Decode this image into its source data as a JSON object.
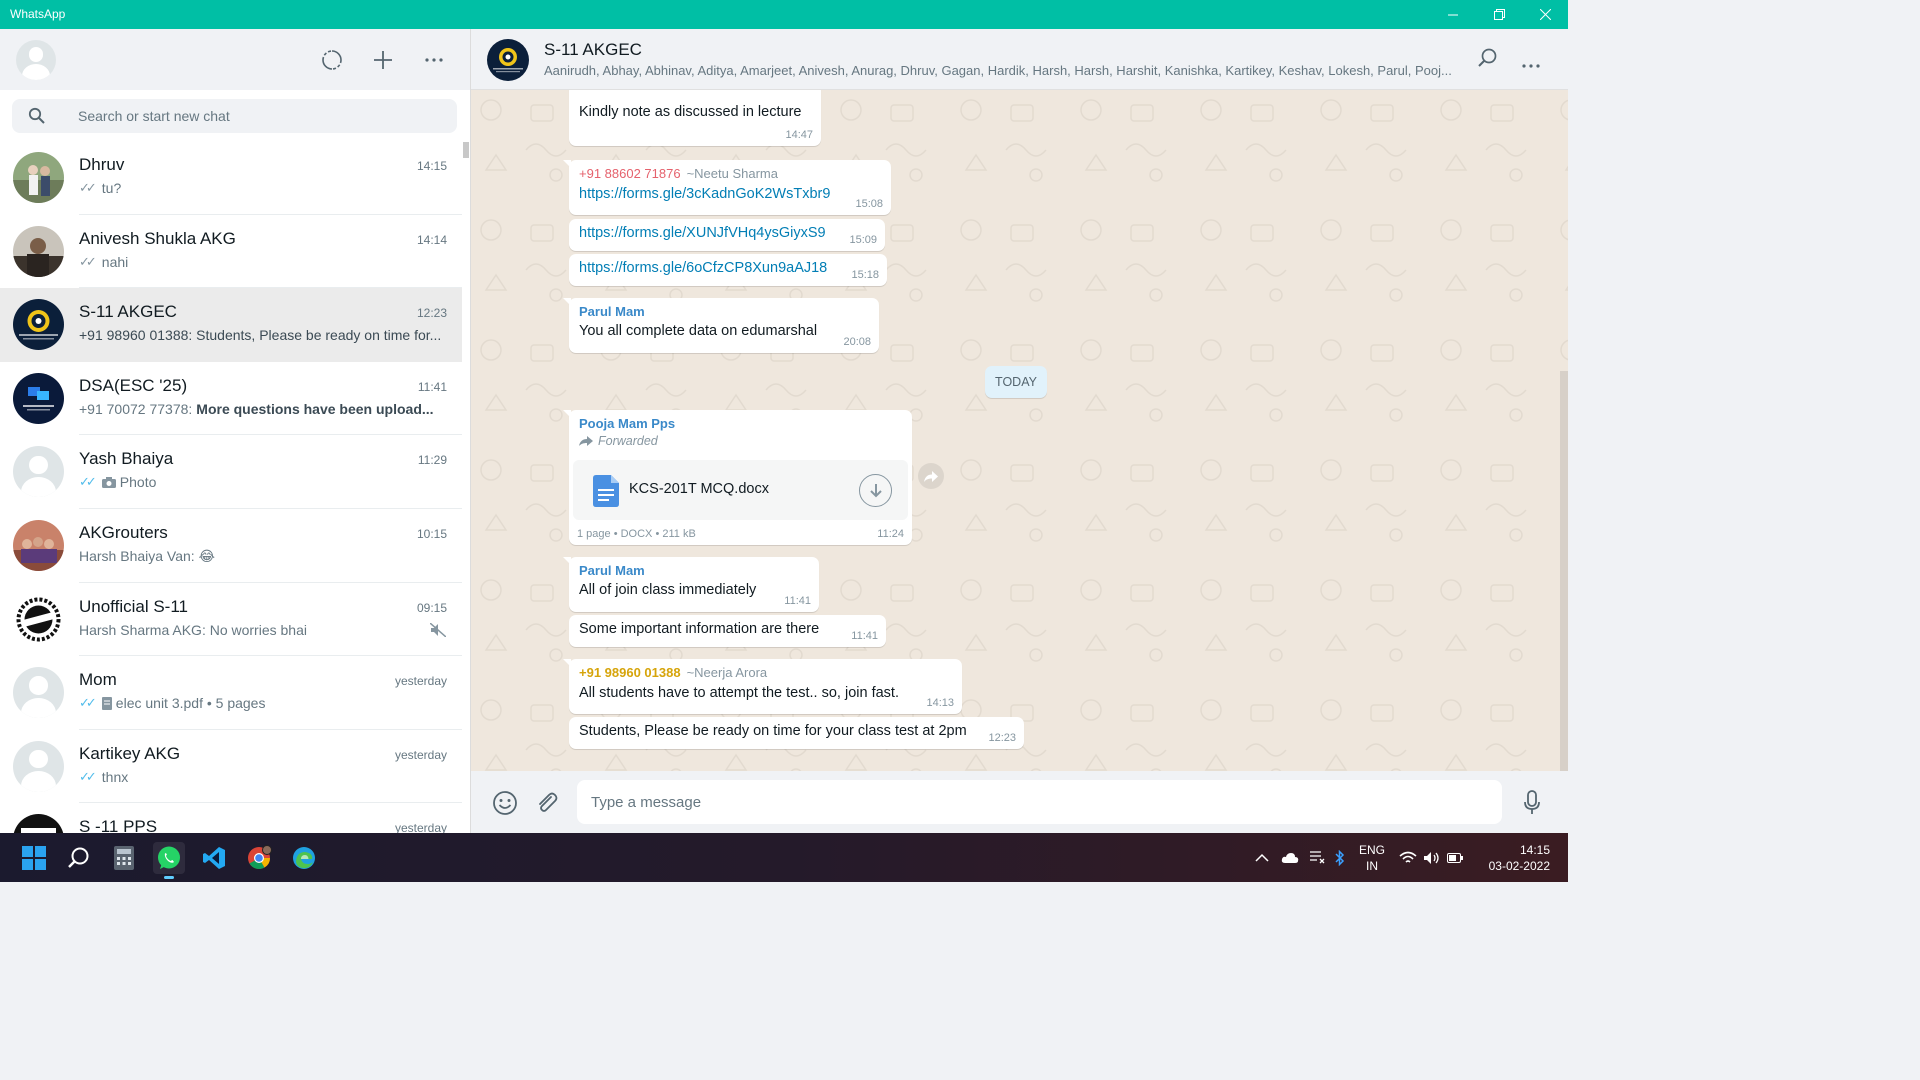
{
  "window": {
    "title": "WhatsApp"
  },
  "left_panel": {
    "search_placeholder": "Search or start new chat",
    "chats": [
      {
        "name": "Dhruv",
        "time": "14:15",
        "tick": "sent",
        "preview": "tu?"
      },
      {
        "name": "Anivesh Shukla AKG",
        "time": "14:14",
        "tick": "sent",
        "preview": "nahi"
      },
      {
        "name": "S-11 AKGEC",
        "time": "12:23",
        "preview": "+91 98960 01388: Students, Please be ready on time for..."
      },
      {
        "name": "DSA(ESC '25)",
        "time": "11:41",
        "preview_prefix": "+91 70072 77378: ",
        "preview_bold": "More questions have been upload..."
      },
      {
        "name": "Yash Bhaiya",
        "time": "11:29",
        "tick": "read",
        "preview": "Photo"
      },
      {
        "name": "AKGrouters",
        "time": "10:15",
        "preview": "Harsh Bhaiya Van: 😂"
      },
      {
        "name": "Unofficial S-11",
        "time": "09:15",
        "preview": "Harsh Sharma AKG: No worries bhai"
      },
      {
        "name": "Mom",
        "time": "yesterday",
        "tick": "read",
        "preview": "elec unit 3.pdf • 5 pages"
      },
      {
        "name": "Kartikey AKG",
        "time": "yesterday",
        "tick": "read",
        "preview": "thnx"
      },
      {
        "name": "S -11 PPS",
        "time": "yesterday",
        "preview": ""
      }
    ]
  },
  "conversation": {
    "title": "S-11 AKGEC",
    "members": "Aanirudh, Abhay, Abhinav, Aditya, Amarjeet, Anivesh, Anurag, Dhruv, Gagan, Hardik, Harsh, Harsh, Harshit, Kanishka, Kartikey, Keshav, Lokesh, Parul, Pooj...",
    "day_chip": "TODAY",
    "messages": {
      "m1_text": "Kindly note as discussed in lecture",
      "m1_time": "14:47",
      "m2_sender": "+91 88602 71876",
      "m2_alias": "~Neetu Sharma",
      "m2_link": "https://forms.gle/3cKadnGoK2WsTxbr9",
      "m2_time": "15:08",
      "m3_link": "https://forms.gle/XUNJfVHq4ysGiyxS9",
      "m3_time": "15:09",
      "m4_link": "https://forms.gle/6oCfzCP8Xun9aAJ18",
      "m4_time": "15:18",
      "m5_sender": "Parul Mam",
      "m5_text": "You all complete data on edumarshal",
      "m5_time": "20:08",
      "m6_sender": "Pooja Mam Pps",
      "m6_forwarded": "Forwarded",
      "m6_doc_name": "KCS-201T MCQ.docx",
      "m6_doc_meta": "1 page • DOCX • 211 kB",
      "m6_time": "11:24",
      "m7_sender": "Parul Mam",
      "m7_text": "All of join class immediately",
      "m7_time": "11:41",
      "m8_text": "Some important information are there",
      "m8_time": "11:41",
      "m9_sender": "+91 98960 01388",
      "m9_alias": "~Neerja Arora",
      "m9_text": "All students have to attempt the test.. so, join fast.",
      "m9_time": "14:13",
      "m10_text": "Students, Please be ready on time for your class test at 2pm",
      "m10_time": "12:23"
    },
    "compose_placeholder": "Type a message"
  },
  "taskbar": {
    "lang_top": "ENG",
    "lang_bottom": "IN",
    "time": "14:15",
    "date": "03-02-2022"
  },
  "colors": {
    "titlebar": "#00bfa5",
    "sender_blue": "#3a89c9",
    "sender_red": "#e5626d",
    "sender_yellow": "#d6a40a",
    "link": "#027eb5",
    "read_tick": "#53bdeb"
  }
}
